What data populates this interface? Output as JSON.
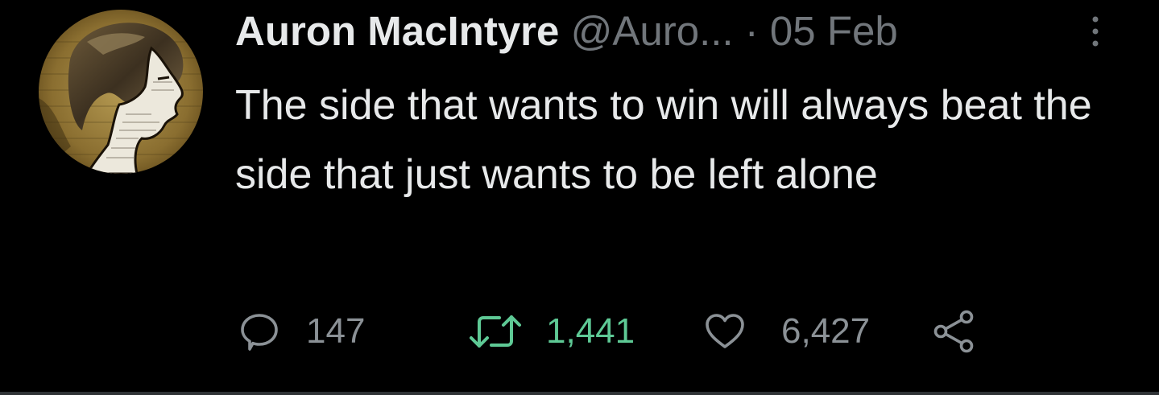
{
  "tweet": {
    "author": {
      "display_name": "Auron MacIntyre",
      "handle": "@Auro...",
      "separator": "·",
      "date": "05 Feb",
      "avatar_icon": "collage-profile-silhouette-avatar"
    },
    "text": "The side that wants to win will always beat the side that just wants to be left alone",
    "more_icon": "vertical-dots-icon",
    "actions": {
      "reply": {
        "icon": "speech-bubble-icon",
        "count": "147"
      },
      "retweet": {
        "icon": "retweet-icon",
        "count": "1,441",
        "active": true
      },
      "like": {
        "icon": "heart-icon",
        "count": "6,427"
      },
      "share": {
        "icon": "share-icon"
      }
    }
  },
  "colors": {
    "background": "#000000",
    "primary_text": "#e7e9ea",
    "secondary_text": "#71767b",
    "retweet_active": "#5ec995",
    "border": "#2f3336"
  }
}
